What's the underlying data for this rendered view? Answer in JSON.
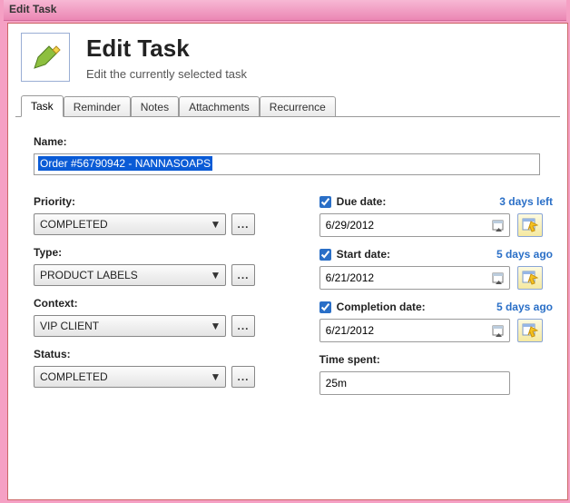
{
  "window": {
    "title": "Edit Task"
  },
  "header": {
    "title": "Edit Task",
    "subtitle": "Edit the currently selected task"
  },
  "tabs": [
    "Task",
    "Reminder",
    "Notes",
    "Attachments",
    "Recurrence"
  ],
  "form": {
    "name_label": "Name:",
    "name_value": "Order #56790942 - NANNASOAPS",
    "priority_label": "Priority:",
    "priority_value": "COMPLETED",
    "type_label": "Type:",
    "type_value": "PRODUCT LABELS",
    "context_label": "Context:",
    "context_value": "VIP CLIENT",
    "status_label": "Status:",
    "status_value": "COMPLETED",
    "due_label": "Due date:",
    "due_value": "6/29/2012",
    "due_relative": "3 days left",
    "start_label": "Start date:",
    "start_value": "6/21/2012",
    "start_relative": "5 days ago",
    "completion_label": "Completion date:",
    "completion_value": "6/21/2012",
    "completion_relative": "5 days ago",
    "timespent_label": "Time spent:",
    "timespent_value": "25m",
    "ellipsis": "..."
  }
}
